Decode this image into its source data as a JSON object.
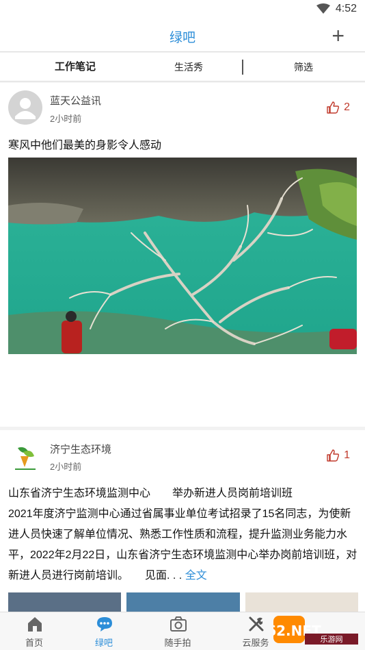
{
  "status": {
    "time": "4:52"
  },
  "header": {
    "title": "绿吧",
    "add_label": "+"
  },
  "tabs": [
    {
      "label": "工作笔记"
    },
    {
      "label": "生活秀"
    },
    {
      "label": "筛选"
    }
  ],
  "posts": [
    {
      "author": "蓝天公益讯",
      "time": "2小时前",
      "likes": "2",
      "title": "寒风中他们最美的身影令人感动"
    },
    {
      "author": "济宁生态环境",
      "time": "2小时前",
      "likes": "1",
      "title": "山东省济宁生态环境监测中心　　举办新进人员岗前培训班",
      "body": "2021年度济宁监测中心通过省属事业单位考试招录了15名同志，为使新进人员快速了解单位情况、熟悉工作性质和流程，提升监测业务能力水平，2022年2月22日，山东省济宁生态环境监测中心举办岗前培训班，对新进人员进行岗前培训。　　见面. . .",
      "more_label": "全文"
    }
  ],
  "bottom_nav": [
    {
      "label": "首页",
      "icon": "home-icon"
    },
    {
      "label": "绿吧",
      "icon": "chat-icon"
    },
    {
      "label": "随手拍",
      "icon": "camera-icon"
    },
    {
      "label": "云服务",
      "icon": "tools-icon"
    }
  ],
  "watermark": {
    "text": "962.NET",
    "subtext": "乐游网"
  },
  "colors": {
    "accent": "#2d8ed8",
    "like": "#c0392b"
  }
}
